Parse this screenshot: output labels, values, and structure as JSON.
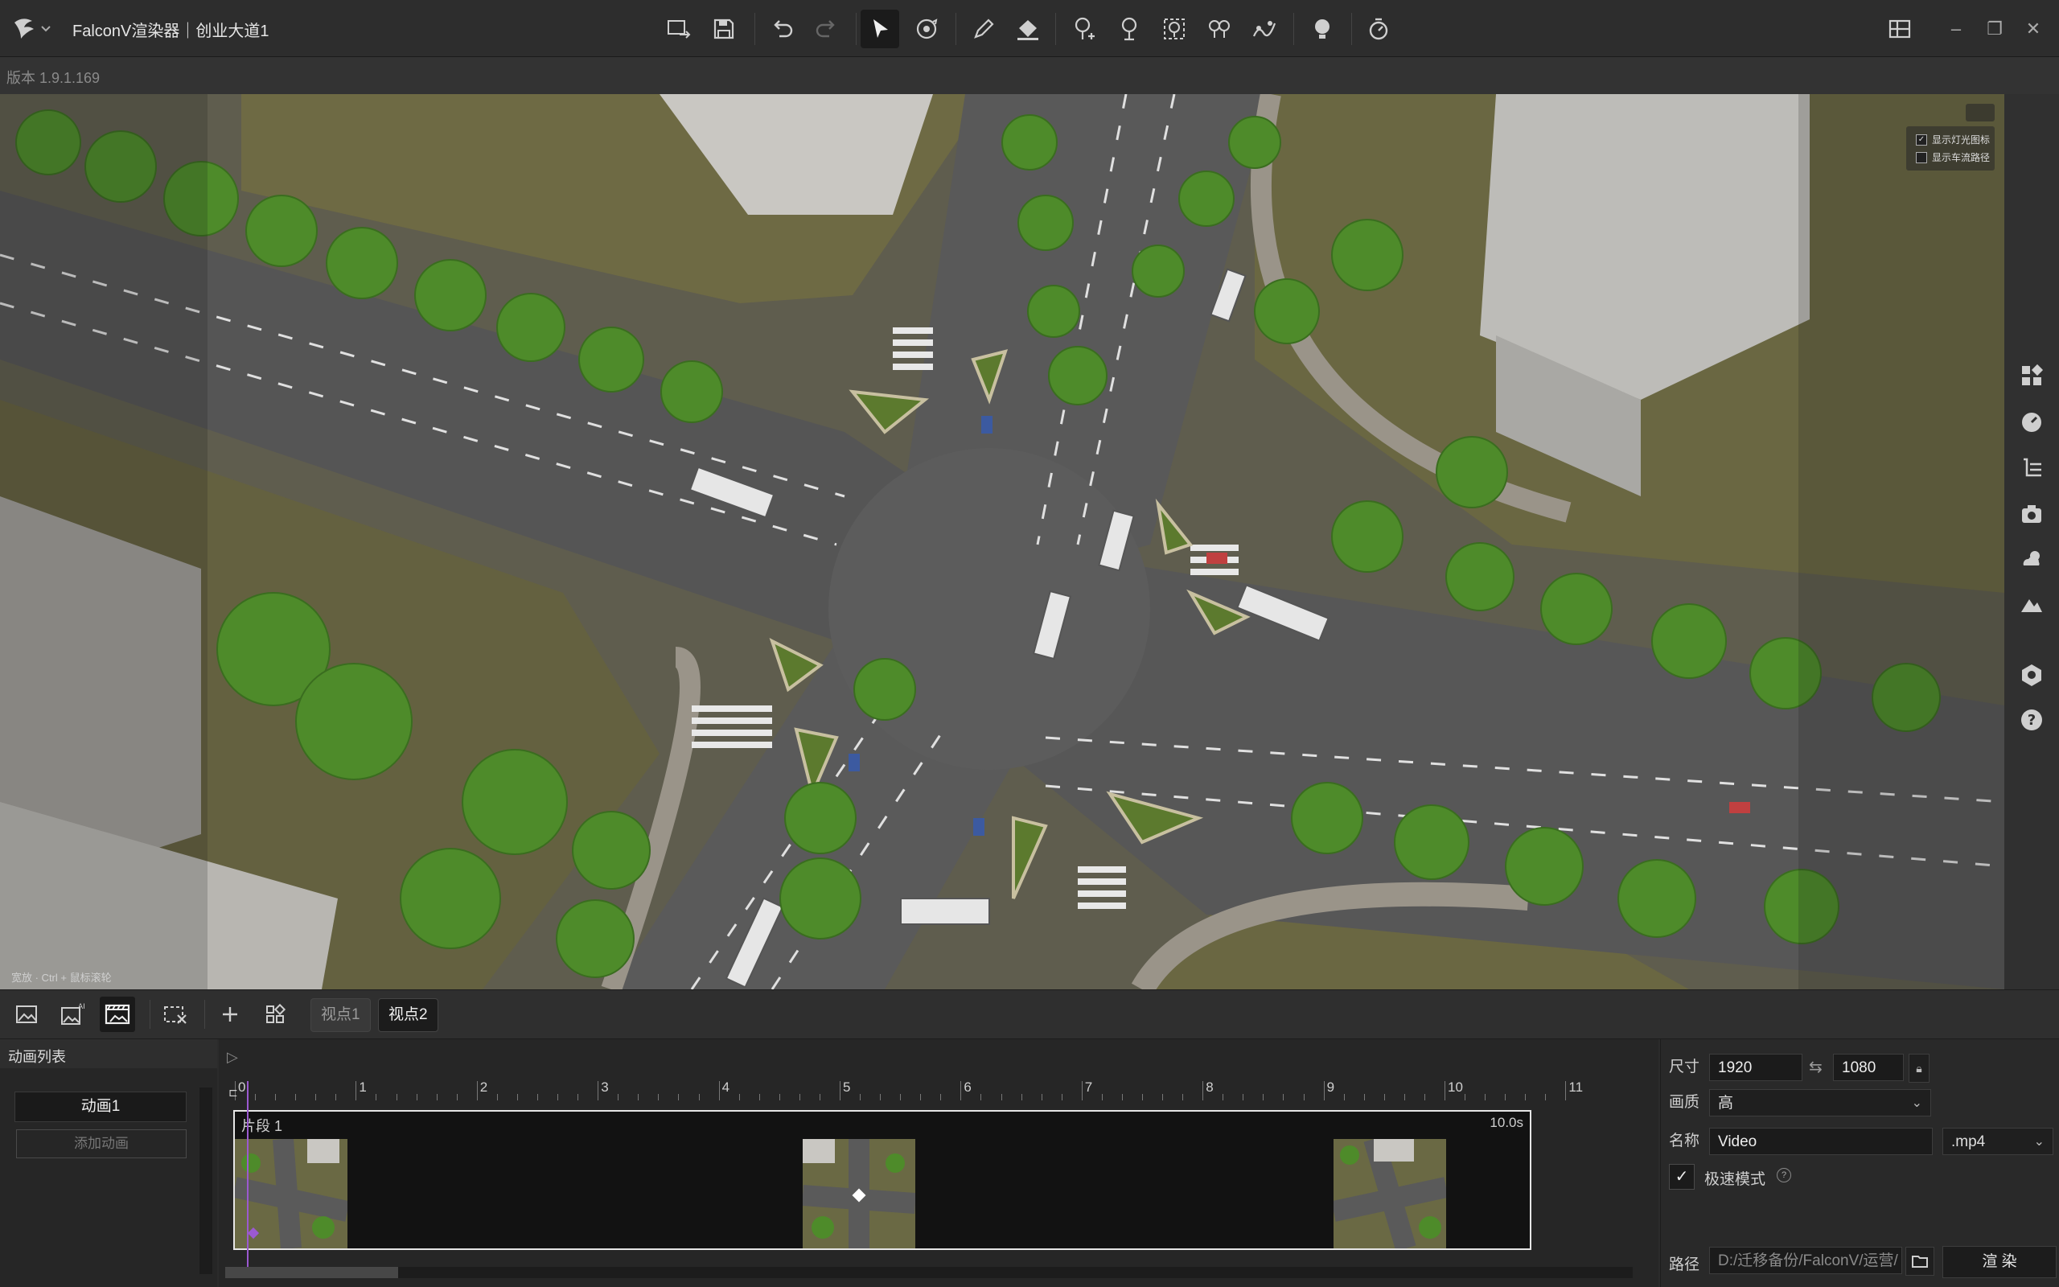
{
  "app": {
    "title": "FalconV渲染器｜创业大道1",
    "version": "版本 1.9.1.169"
  },
  "viewport": {
    "hint": "宽放 · Ctrl + 鼠标滚轮",
    "overlay": [
      {
        "label": "显示灯光图标",
        "checked": true
      },
      {
        "label": "显示车流路径",
        "checked": false
      }
    ]
  },
  "views": {
    "tabs": [
      "视点1",
      "视点2"
    ],
    "active": 1
  },
  "animation_list": {
    "title": "动画列表",
    "items": [
      "动画1"
    ],
    "add_label": "添加动画"
  },
  "timeline": {
    "ticks": [
      "0",
      "1",
      "2",
      "3",
      "4",
      "5",
      "6",
      "7",
      "8",
      "9",
      "10",
      "11"
    ],
    "segment_label": "片段 1",
    "segment_duration": "10.0s",
    "playhead_seconds": 0.1
  },
  "render_settings": {
    "size_label": "尺寸",
    "width": "1920",
    "height": "1080",
    "quality_label": "画质",
    "quality_value": "高",
    "name_label": "名称",
    "name_value": "Video",
    "format_value": ".mp4",
    "fast_mode_label": "极速模式",
    "fast_mode_checked": true,
    "path_label": "路径",
    "path_value": "D:/迁移备份/FalconV/运营/",
    "render_button": "渲 染"
  },
  "colors": {
    "accent": "#9b59d0",
    "road": "#5c5c5c",
    "grass": "#6b6a3e",
    "tree": "#4f8a2a"
  }
}
